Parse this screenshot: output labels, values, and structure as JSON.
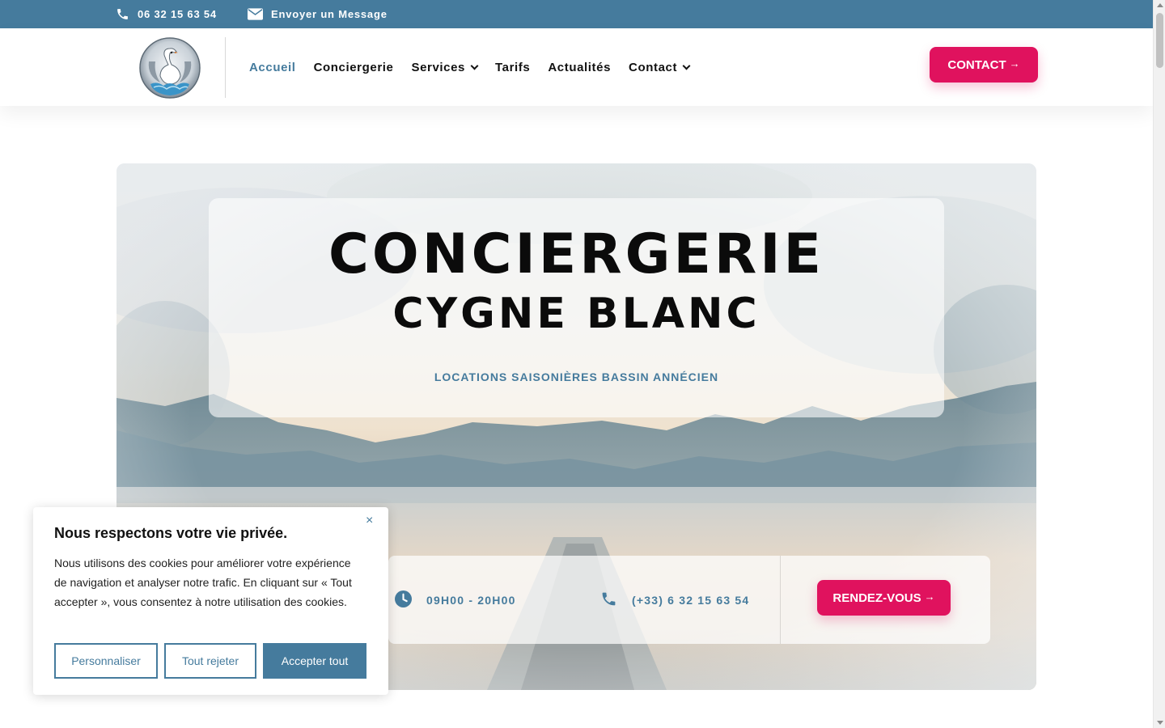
{
  "topbar": {
    "phone": "06 32 15 63 54",
    "message": "Envoyer un Message",
    "icons": [
      "phone-icon",
      "mail-icon"
    ]
  },
  "header": {
    "logo_icon": "swan-logo",
    "nav": [
      {
        "label": "Accueil",
        "active": true
      },
      {
        "label": "Conciergerie"
      },
      {
        "label": "Services",
        "dropdown": true
      },
      {
        "label": "Tarifs"
      },
      {
        "label": "Actualités"
      },
      {
        "label": "Contact",
        "dropdown": true
      }
    ],
    "cta": "CONTACT",
    "cta_arrow": "→"
  },
  "hero": {
    "title_line1": "CONCIERGERIE",
    "title_line2": "CYGNE BLANC",
    "subtitle": "LOCATIONS SAISONIÈRES BASSIN ANNÉCIEN",
    "hours": "09H00 - 20H00",
    "phone": "(+33) 6 32 15 63 54",
    "cta": "RENDEZ-VOUS",
    "cta_arrow": "→",
    "icons": [
      "clock-icon",
      "phone-icon"
    ]
  },
  "cookie": {
    "title": "Nous respectons votre vie privée.",
    "close": "×",
    "text": "Nous utilisons des cookies pour améliorer votre expérience de navigation et analyser notre trafic. En cliquant sur « Tout accepter », vous consentez à notre utilisation des cookies.",
    "customize": "Personnaliser",
    "reject": "Tout rejeter",
    "accept": "Accepter tout"
  },
  "colors": {
    "brand_blue": "#457b9d",
    "accent_pink": "#e0125e"
  }
}
